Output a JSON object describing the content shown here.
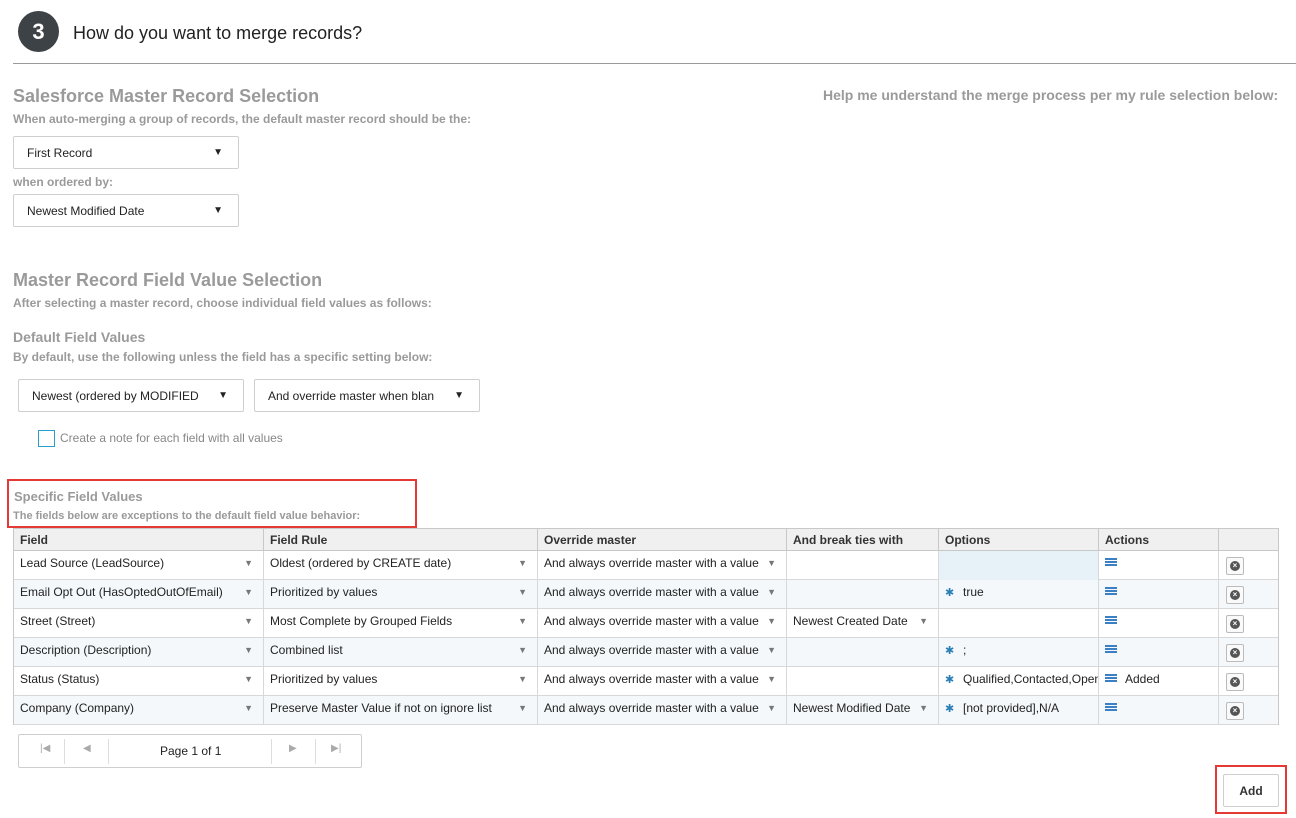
{
  "step": {
    "number": "3",
    "title": "How do you want to merge records?"
  },
  "help_text": "Help me understand the merge process per my rule selection below: ",
  "master_selection": {
    "title": "Salesforce Master Record Selection",
    "description": "When auto-merging a group of records, the default master record should be the:",
    "record_select": "First Record",
    "ordered_by_label": "when ordered by:",
    "order_select": "Newest Modified Date"
  },
  "field_value_selection": {
    "title": "Master Record Field Value Selection",
    "description": "After selecting a master record, choose individual field values as follows:"
  },
  "default_values": {
    "title": "Default Field Values",
    "description": "By default, use the following unless the field has a specific setting below:",
    "value_select": "Newest (ordered by MODIFIED",
    "override_select": "And override master when blan",
    "note_checkbox_label": "Create a note for each field with all values"
  },
  "specific_values": {
    "title": "Specific Field Values",
    "description": "The fields below are exceptions to the default field value behavior:"
  },
  "table": {
    "headers": [
      "Field",
      "Field Rule",
      "Override master",
      "And break ties with",
      "Options",
      "Actions"
    ],
    "rows": [
      {
        "field": "Lead Source (LeadSource)",
        "rule": "Oldest (ordered by CREATE date)",
        "override": "And always override master with a value",
        "tie": "",
        "options": "",
        "actions": ""
      },
      {
        "field": "Email Opt Out (HasOptedOutOfEmail)",
        "rule": "Prioritized by values",
        "override": "And always override master with a value",
        "tie": "",
        "options": "true",
        "actions": ""
      },
      {
        "field": "Street (Street)",
        "rule": "Most Complete by Grouped Fields",
        "override": "And always override master with a value",
        "tie": "Newest Created Date",
        "options": "",
        "actions": ""
      },
      {
        "field": "Description (Description)",
        "rule": "Combined list",
        "override": "And always override master with a value",
        "tie": "",
        "options": ";",
        "actions": ""
      },
      {
        "field": "Status (Status)",
        "rule": "Prioritized by values",
        "override": "And always override master with a value",
        "tie": "",
        "options": "Qualified,Contacted,Open",
        "actions": "Added"
      },
      {
        "field": "Company (Company)",
        "rule": "Preserve Master Value if not on ignore list",
        "override": "And always override master with a value",
        "tie": "Newest Modified Date",
        "options": "[not provided],N/A",
        "actions": ""
      }
    ]
  },
  "pager": {
    "label": "Page 1 of 1"
  },
  "add_button": "Add",
  "icons": {
    "gear": "gear-icon",
    "list": "list-icon",
    "delete": "delete-icon",
    "dropdown": "chevron-down-icon"
  },
  "colors": {
    "highlight": "#e53935",
    "step_circle": "#3d4247",
    "checkbox": "#2aa0c8",
    "icon_blue": "#2b7fb5"
  }
}
